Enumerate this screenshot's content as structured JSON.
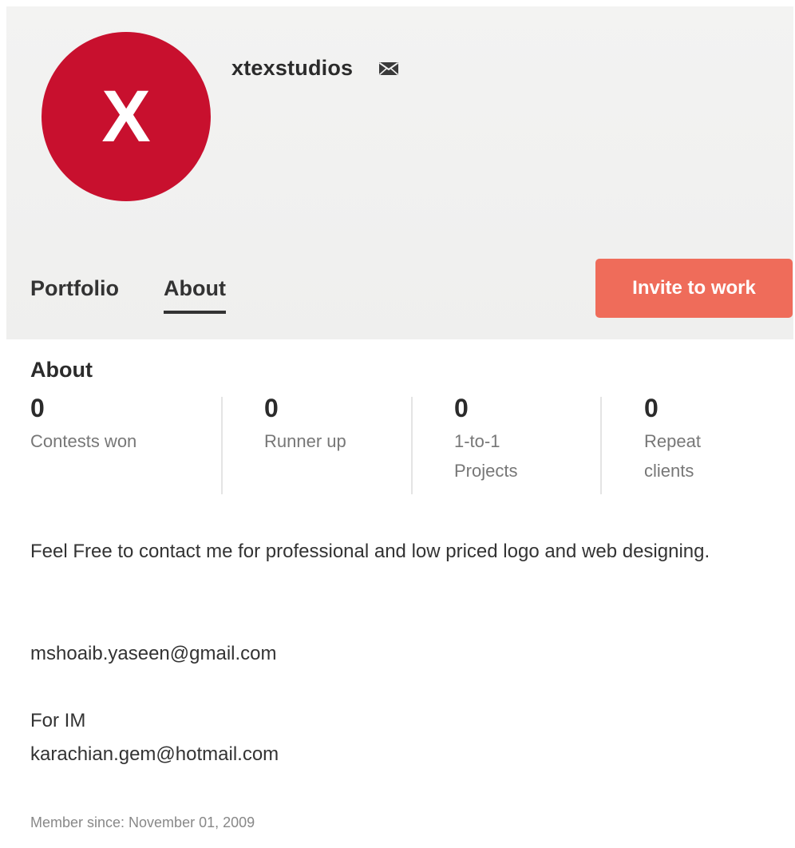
{
  "profile": {
    "avatar_letter": "X",
    "avatar_color": "#c8102e",
    "username": "xtexstudios",
    "message_icon": "envelope-icon"
  },
  "tabs": [
    {
      "label": "Portfolio",
      "active": false
    },
    {
      "label": "About",
      "active": true
    }
  ],
  "invite_button": {
    "label": "Invite to work",
    "color": "#ef6c5a"
  },
  "about": {
    "title": "About",
    "stats": [
      {
        "value": "0",
        "label": "Contests won"
      },
      {
        "value": "0",
        "label": "Runner up"
      },
      {
        "value": "0",
        "label": "1-to-1 Projects"
      },
      {
        "value": "0",
        "label": "Repeat clients"
      }
    ],
    "bio": "Feel Free to contact me for professional and low priced logo and web designing.",
    "email": "mshoaib.yaseen@gmail.com",
    "im_label": "For IM",
    "im_value": "karachian.gem@hotmail.com",
    "member_since": "Member since: November 01, 2009"
  }
}
